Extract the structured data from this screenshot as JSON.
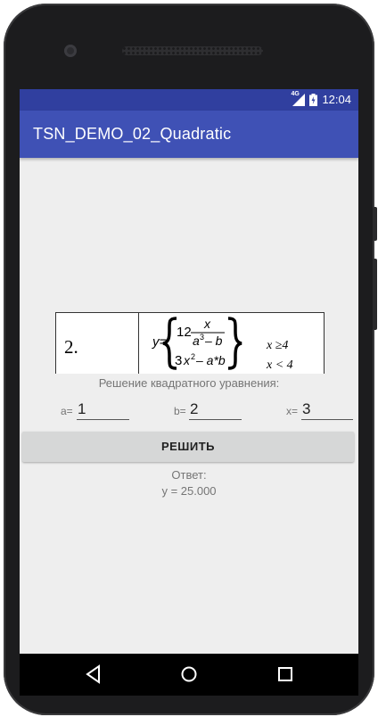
{
  "status_bar": {
    "network": "4G",
    "time": "12:04"
  },
  "app_bar": {
    "title": "TSN_DEMO_02_Quadratic"
  },
  "formula": {
    "number": "2.",
    "lhs": "y=",
    "case1_coef": "12",
    "case1_num": "x",
    "case1_den_a": "a",
    "case1_den_exp": "3",
    "case1_den_rest": "– b",
    "case2_a": "3",
    "case2_x": "x",
    "case2_exp": "2",
    "case2_rest": "– a*b",
    "cond1": "x ≥4",
    "cond2": "x < 4"
  },
  "main": {
    "subtitle": "Решение квадратного уравнения:",
    "fields": [
      {
        "label": "a=",
        "value": "1"
      },
      {
        "label": "b=",
        "value": "2"
      },
      {
        "label": "x=",
        "value": "3"
      }
    ],
    "solve_label": "РЕШИТЬ",
    "answer_label": "Ответ:",
    "answer_value": "y = 25.000"
  },
  "nav_bar": {
    "back": "back-icon",
    "home": "home-icon",
    "recents": "recents-icon"
  }
}
